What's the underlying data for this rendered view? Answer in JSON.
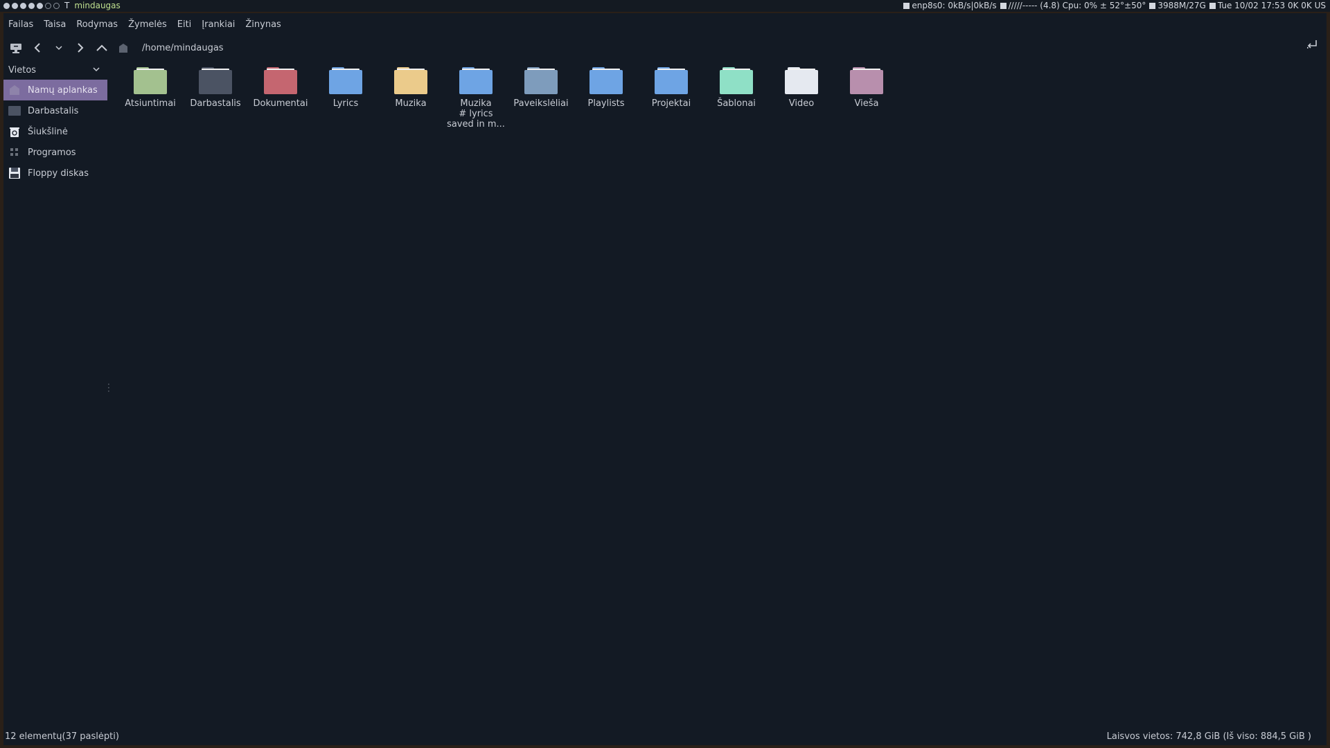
{
  "topbar": {
    "workspaces": [
      "filled",
      "filled",
      "filled",
      "filled",
      "filled",
      "empty",
      "empty"
    ],
    "layout_indicator": "T",
    "window_title": "mindaugas",
    "net": "enp8s0: 0kB/s|0kB/s",
    "cpu": "/////----- (4.8) Cpu: 0% ± 52°±50°",
    "mem": "3988M/27G",
    "clock": "Tue 10/02 17:53 0K 0K US"
  },
  "menu": [
    "Failas",
    "Taisa",
    "Rodymas",
    "Žymelės",
    "Eiti",
    "Įrankiai",
    "Žinynas"
  ],
  "toolbar": {
    "path": "/home/mindaugas",
    "icons": [
      "new-window-icon",
      "back-icon",
      "history-dropdown-icon",
      "forward-icon",
      "up-icon",
      "home-icon",
      "path-toggle-icon"
    ]
  },
  "sidebar": {
    "header": "Vietos",
    "items": [
      {
        "label": "Namų aplankas",
        "icon": "home-folder-icon",
        "selected": true
      },
      {
        "label": "Darbastalis",
        "icon": "desktop-icon",
        "selected": false
      },
      {
        "label": "Šiukšlinė",
        "icon": "trash-icon",
        "selected": false
      },
      {
        "label": "Programos",
        "icon": "applications-icon",
        "selected": false
      },
      {
        "label": "Floppy diskas",
        "icon": "floppy-icon",
        "selected": false
      }
    ]
  },
  "files": [
    {
      "name": "Atsiuntimai",
      "color": "#a3c18f",
      "line2": "",
      "line3": ""
    },
    {
      "name": "Darbastalis",
      "color": "#4b5363",
      "line2": "",
      "line3": ""
    },
    {
      "name": "Dokumentai",
      "color": "#c56670",
      "line2": "",
      "line3": ""
    },
    {
      "name": "Lyrics",
      "color": "#6ea4e4",
      "line2": "",
      "line3": ""
    },
    {
      "name": "Muzika",
      "color": "#ebcb8b",
      "line2": "",
      "line3": ""
    },
    {
      "name": "Muzika",
      "color": "#6ea4e4",
      "line2": "# lyrics",
      "line3": "saved in m..."
    },
    {
      "name": "Paveikslėliai",
      "color": "#7e9cbc",
      "line2": "",
      "line3": ""
    },
    {
      "name": "Playlists",
      "color": "#6ea4e4",
      "line2": "",
      "line3": ""
    },
    {
      "name": "Projektai",
      "color": "#6ea4e4",
      "line2": "",
      "line3": ""
    },
    {
      "name": "Šablonai",
      "color": "#8fe0c6",
      "line2": "",
      "line3": ""
    },
    {
      "name": "Video",
      "color": "#e5e9f0",
      "line2": "",
      "line3": ""
    },
    {
      "name": "Vieša",
      "color": "#b88fad",
      "line2": "",
      "line3": ""
    }
  ],
  "status": {
    "left": "12 elementų(37 paslėpti)",
    "right": "Laisvos vietos: 742,8 GiB (Iš viso: 884,5 GiB )"
  }
}
